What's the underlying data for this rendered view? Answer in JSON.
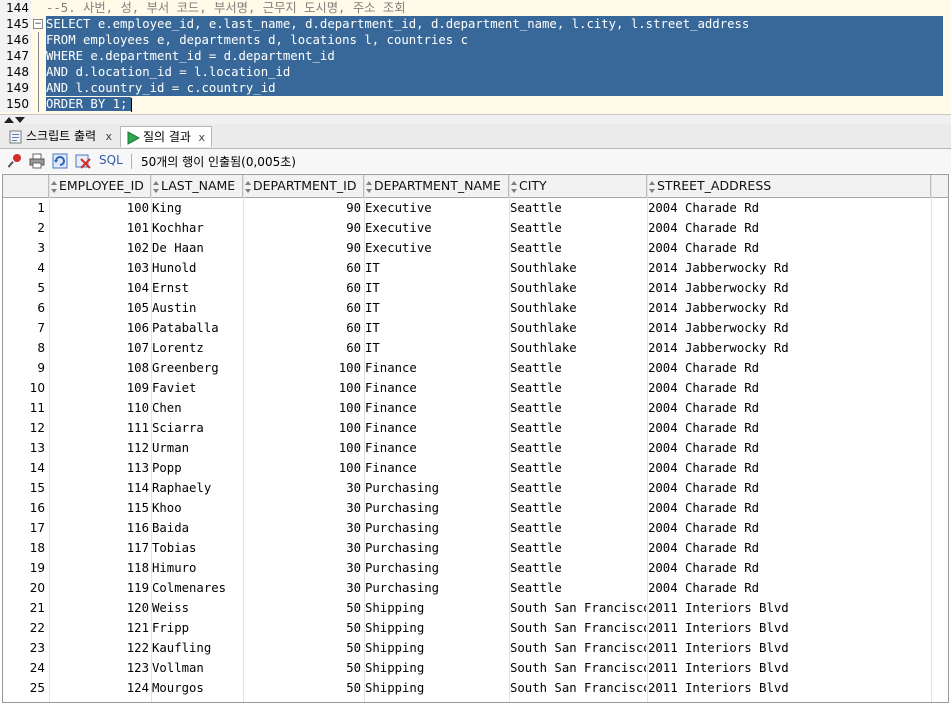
{
  "editor": {
    "lines": [
      {
        "num": "144",
        "text": "--5. 사번, 성, 부서 코드, 부서명, 근무지 도시명, 주소 조회",
        "kind": "comment"
      },
      {
        "num": "145",
        "text": "SELECT e.employee_id, e.last_name, d.department_id, d.department_name, l.city, l.street_address",
        "kind": "sel"
      },
      {
        "num": "146",
        "text": "FROM employees e, departments d, locations l, countries c",
        "kind": "sel"
      },
      {
        "num": "147",
        "text": "WHERE e.department_id = d.department_id",
        "kind": "sel"
      },
      {
        "num": "148",
        "text": "AND d.location_id = l.location_id",
        "kind": "sel"
      },
      {
        "num": "149",
        "text": "AND l.country_id = c.country_id",
        "kind": "sel"
      },
      {
        "num": "150",
        "text": "ORDER BY 1;",
        "kind": "sel-last"
      }
    ]
  },
  "tabs": [
    {
      "label": "스크립트 출력",
      "close": "x",
      "icon": "script-output-icon"
    },
    {
      "label": "질의 결과",
      "close": "x",
      "icon": "run-query-icon"
    }
  ],
  "toolbar": {
    "sql_label": "SQL",
    "status": "50개의 행이 인출됨(0,005초)"
  },
  "grid": {
    "columns": [
      "EMPLOYEE_ID",
      "LAST_NAME",
      "DEPARTMENT_ID",
      "DEPARTMENT_NAME",
      "CITY",
      "STREET_ADDRESS"
    ],
    "rows": [
      [
        "1",
        "100",
        "King",
        "90",
        "Executive",
        "Seattle",
        "2004 Charade Rd"
      ],
      [
        "2",
        "101",
        "Kochhar",
        "90",
        "Executive",
        "Seattle",
        "2004 Charade Rd"
      ],
      [
        "3",
        "102",
        "De Haan",
        "90",
        "Executive",
        "Seattle",
        "2004 Charade Rd"
      ],
      [
        "4",
        "103",
        "Hunold",
        "60",
        "IT",
        "Southlake",
        "2014 Jabberwocky Rd"
      ],
      [
        "5",
        "104",
        "Ernst",
        "60",
        "IT",
        "Southlake",
        "2014 Jabberwocky Rd"
      ],
      [
        "6",
        "105",
        "Austin",
        "60",
        "IT",
        "Southlake",
        "2014 Jabberwocky Rd"
      ],
      [
        "7",
        "106",
        "Pataballa",
        "60",
        "IT",
        "Southlake",
        "2014 Jabberwocky Rd"
      ],
      [
        "8",
        "107",
        "Lorentz",
        "60",
        "IT",
        "Southlake",
        "2014 Jabberwocky Rd"
      ],
      [
        "9",
        "108",
        "Greenberg",
        "100",
        "Finance",
        "Seattle",
        "2004 Charade Rd"
      ],
      [
        "10",
        "109",
        "Faviet",
        "100",
        "Finance",
        "Seattle",
        "2004 Charade Rd"
      ],
      [
        "11",
        "110",
        "Chen",
        "100",
        "Finance",
        "Seattle",
        "2004 Charade Rd"
      ],
      [
        "12",
        "111",
        "Sciarra",
        "100",
        "Finance",
        "Seattle",
        "2004 Charade Rd"
      ],
      [
        "13",
        "112",
        "Urman",
        "100",
        "Finance",
        "Seattle",
        "2004 Charade Rd"
      ],
      [
        "14",
        "113",
        "Popp",
        "100",
        "Finance",
        "Seattle",
        "2004 Charade Rd"
      ],
      [
        "15",
        "114",
        "Raphaely",
        "30",
        "Purchasing",
        "Seattle",
        "2004 Charade Rd"
      ],
      [
        "16",
        "115",
        "Khoo",
        "30",
        "Purchasing",
        "Seattle",
        "2004 Charade Rd"
      ],
      [
        "17",
        "116",
        "Baida",
        "30",
        "Purchasing",
        "Seattle",
        "2004 Charade Rd"
      ],
      [
        "18",
        "117",
        "Tobias",
        "30",
        "Purchasing",
        "Seattle",
        "2004 Charade Rd"
      ],
      [
        "19",
        "118",
        "Himuro",
        "30",
        "Purchasing",
        "Seattle",
        "2004 Charade Rd"
      ],
      [
        "20",
        "119",
        "Colmenares",
        "30",
        "Purchasing",
        "Seattle",
        "2004 Charade Rd"
      ],
      [
        "21",
        "120",
        "Weiss",
        "50",
        "Shipping",
        "South San Francisco",
        "2011 Interiors Blvd"
      ],
      [
        "22",
        "121",
        "Fripp",
        "50",
        "Shipping",
        "South San Francisco",
        "2011 Interiors Blvd"
      ],
      [
        "23",
        "122",
        "Kaufling",
        "50",
        "Shipping",
        "South San Francisco",
        "2011 Interiors Blvd"
      ],
      [
        "24",
        "123",
        "Vollman",
        "50",
        "Shipping",
        "South San Francisco",
        "2011 Interiors Blvd"
      ],
      [
        "25",
        "124",
        "Mourgos",
        "50",
        "Shipping",
        "South San Francisco",
        "2011 Interiors Blvd"
      ]
    ]
  },
  "colors": {
    "selection": "#386899",
    "editor_bg": "#fffbe8",
    "comment": "#808080",
    "run_icon": "#2fa84f"
  }
}
